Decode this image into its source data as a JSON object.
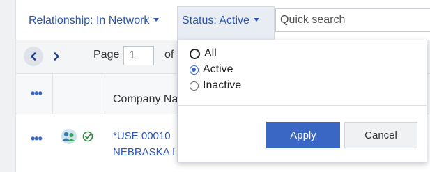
{
  "filters": {
    "relationship_label": "Relationship: In Network",
    "status_label": "Status: Active"
  },
  "search": {
    "placeholder": "Quick search"
  },
  "pager": {
    "page_label": "Page",
    "page_value": "1",
    "of_label": "of"
  },
  "table": {
    "header_menu": "•••",
    "company_header": "Company Na",
    "row_menu": "•••",
    "row_company_line1": "*USE 00010",
    "row_company_line2": "NEBRASKA I"
  },
  "status_dropdown": {
    "options": [
      {
        "label": "All",
        "selected": false
      },
      {
        "label": "Active",
        "selected": true
      },
      {
        "label": "Inactive",
        "selected": false
      }
    ],
    "apply_label": "Apply",
    "cancel_label": "Cancel"
  },
  "colors": {
    "accent": "#3a67c4",
    "link": "#2b57b3",
    "status_ok": "#2e8b3e"
  },
  "icons": [
    "chevron-left-icon",
    "chevron-right-icon",
    "network-people-icon",
    "check-circle-icon",
    "caret-down-icon"
  ]
}
